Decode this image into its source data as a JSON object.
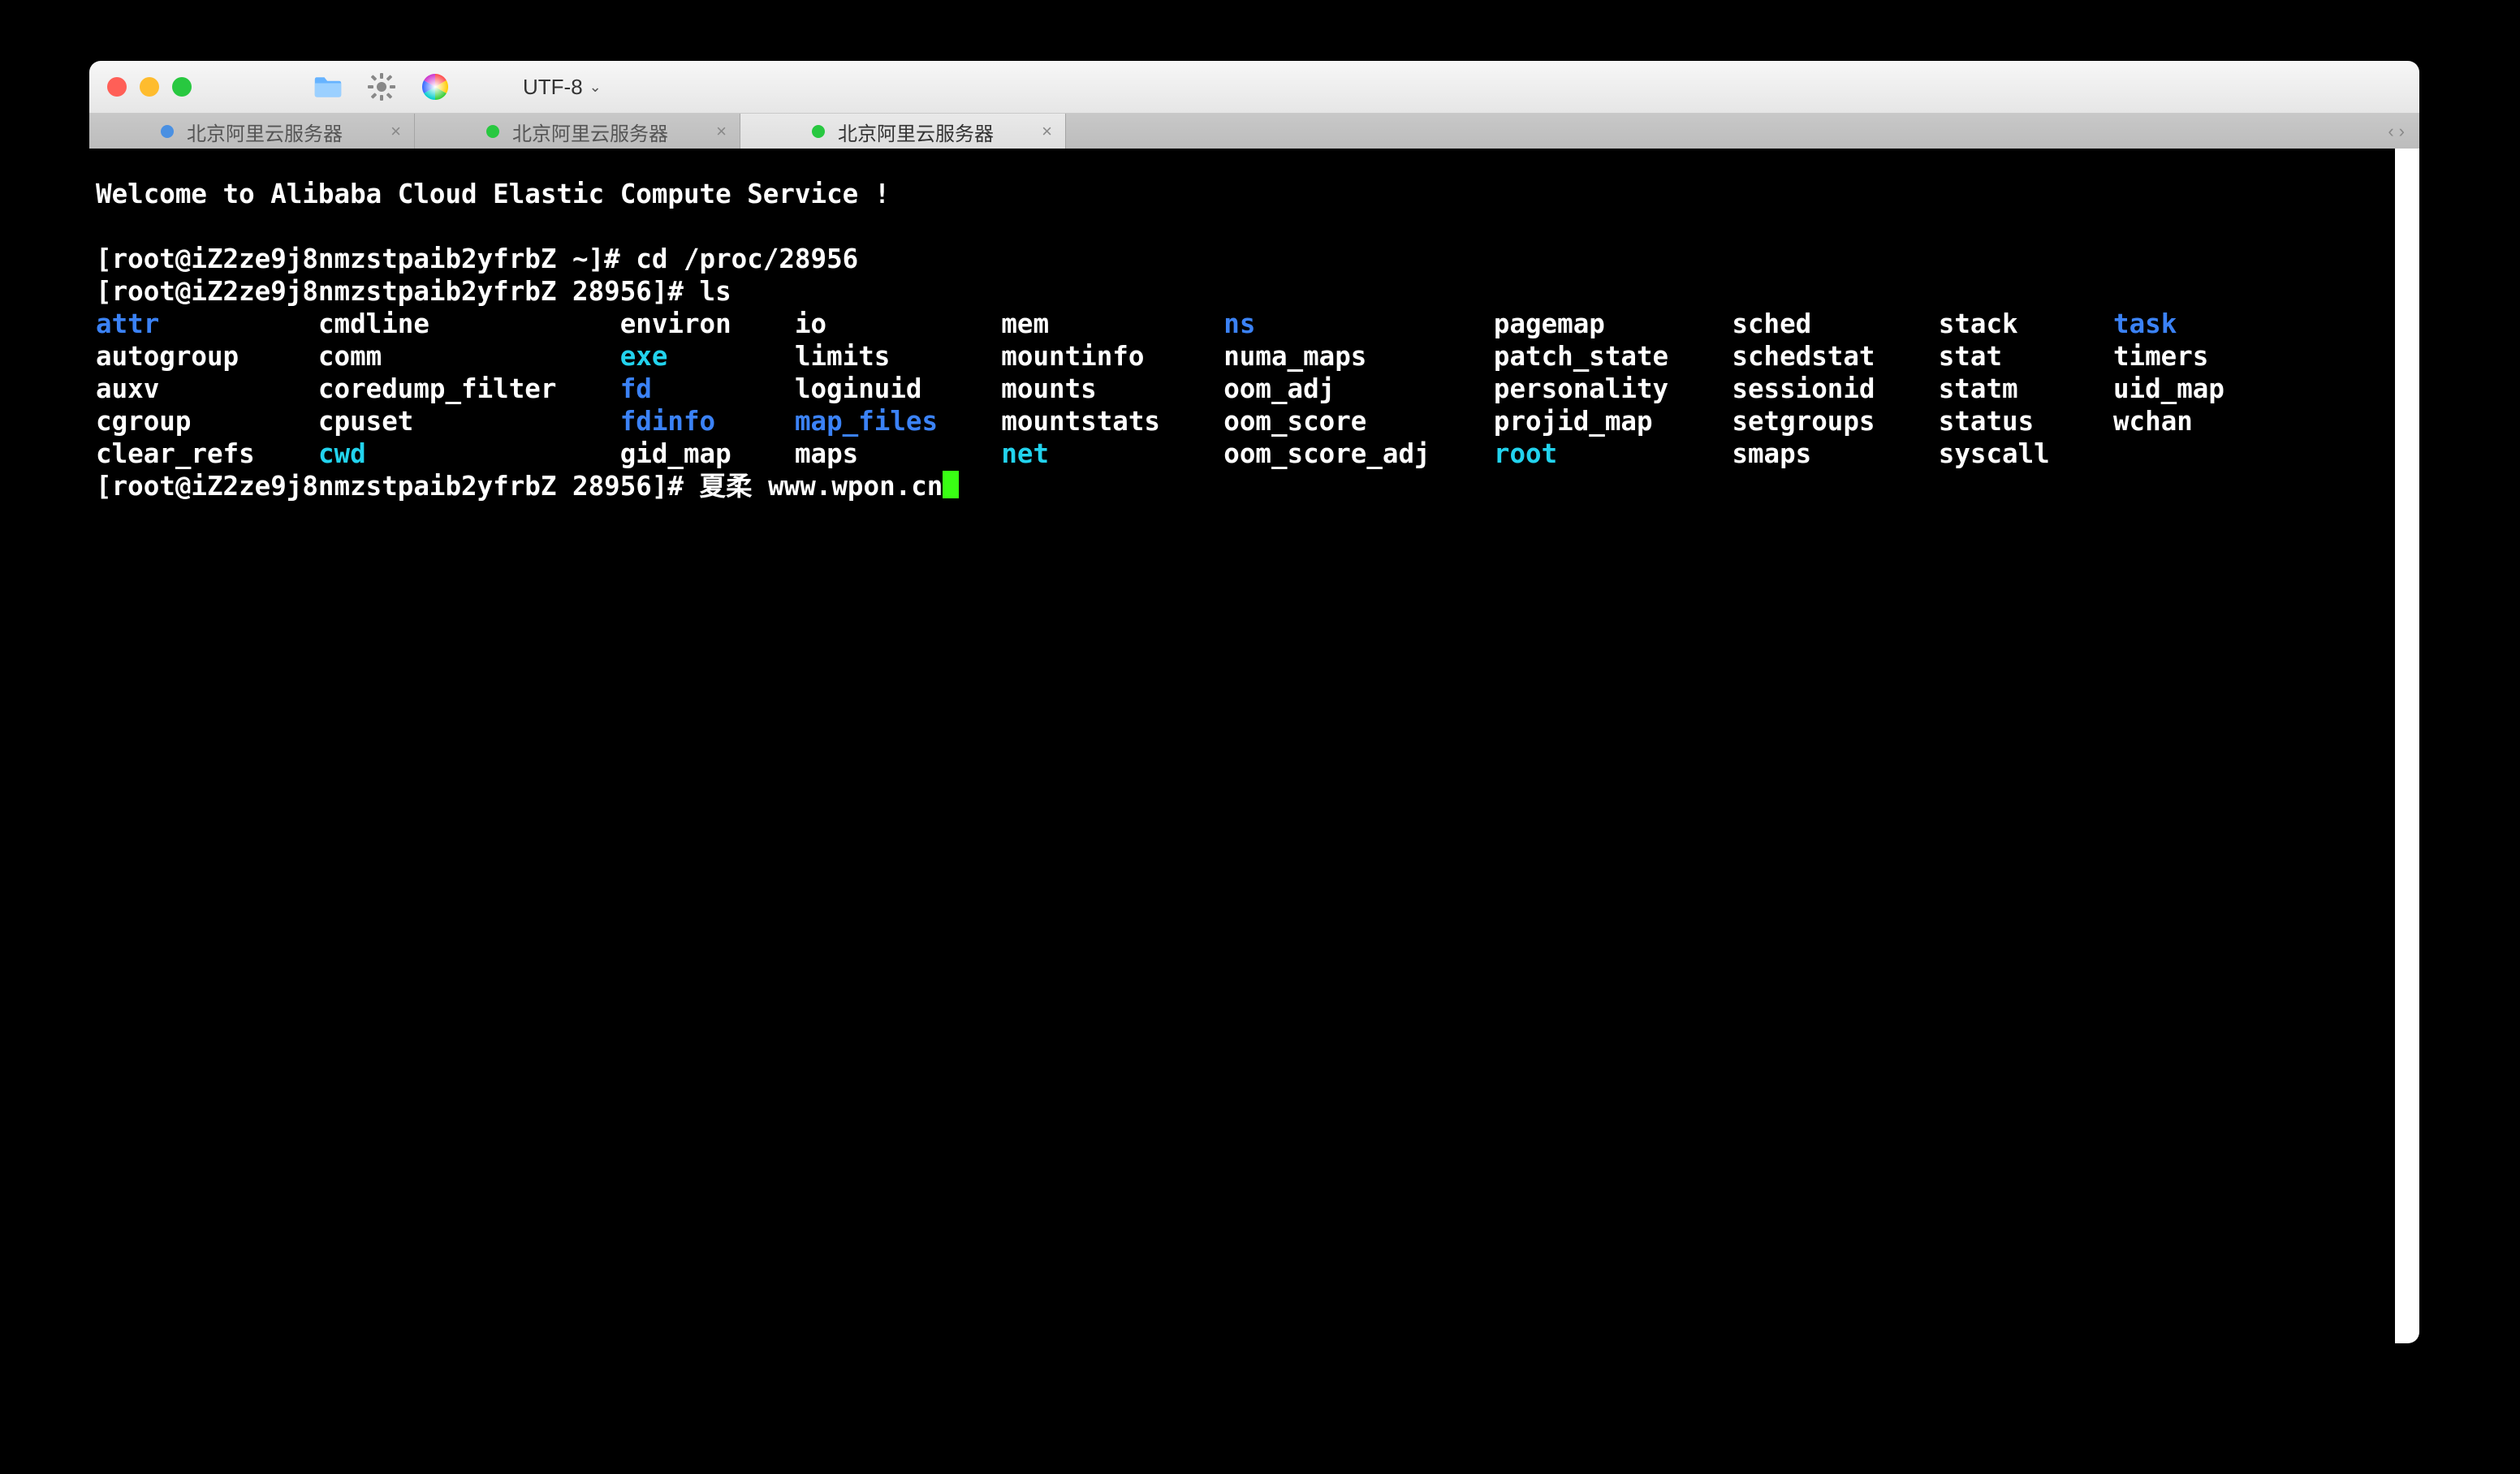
{
  "titlebar": {
    "encoding": "UTF-8",
    "icons": {
      "folder": "folder-icon",
      "gear": "gear-icon",
      "colorwheel": "colorwheel-icon"
    }
  },
  "tabs": [
    {
      "label": "北京阿里云服务器",
      "dot_color": "#4a90e2",
      "active": false
    },
    {
      "label": "北京阿里云服务器",
      "dot_color": "#28c840",
      "active": false
    },
    {
      "label": "北京阿里云服务器",
      "dot_color": "#28c840",
      "active": true
    }
  ],
  "terminal": {
    "welcome": "Welcome to Alibaba Cloud Elastic Compute Service !",
    "lines": [
      {
        "prompt": "[root@iZ2ze9j8nmzstpaib2yfrbZ ~]#",
        "cmd": "cd /proc/28956"
      },
      {
        "prompt": "[root@iZ2ze9j8nmzstpaib2yfrbZ 28956]#",
        "cmd": "ls"
      }
    ],
    "ls": {
      "cols": [
        [
          "attr",
          "autogroup",
          "auxv",
          "cgroup",
          "clear_refs"
        ],
        [
          "cmdline",
          "comm",
          "coredump_filter",
          "cpuset",
          "cwd"
        ],
        [
          "environ",
          "exe",
          "fd",
          "fdinfo",
          "gid_map"
        ],
        [
          "io",
          "limits",
          "loginuid",
          "map_files",
          "maps"
        ],
        [
          "mem",
          "mountinfo",
          "mounts",
          "mountstats",
          "net"
        ],
        [
          "ns",
          "numa_maps",
          "oom_adj",
          "oom_score",
          "oom_score_adj"
        ],
        [
          "pagemap",
          "patch_state",
          "personality",
          "projid_map",
          "root"
        ],
        [
          "sched",
          "schedstat",
          "sessionid",
          "setgroups",
          "smaps"
        ],
        [
          "stack",
          "stat",
          "statm",
          "status",
          "syscall"
        ],
        [
          "task",
          "timers",
          "uid_map",
          "wchan",
          ""
        ]
      ],
      "dirs": [
        "attr",
        "fd",
        "fdinfo",
        "map_files",
        "ns",
        "task"
      ],
      "links": [
        "cwd",
        "exe",
        "root",
        "net"
      ]
    },
    "current": {
      "prompt": "[root@iZ2ze9j8nmzstpaib2yfrbZ 28956]#",
      "input": "夏柔 www.wpon.cn"
    }
  }
}
